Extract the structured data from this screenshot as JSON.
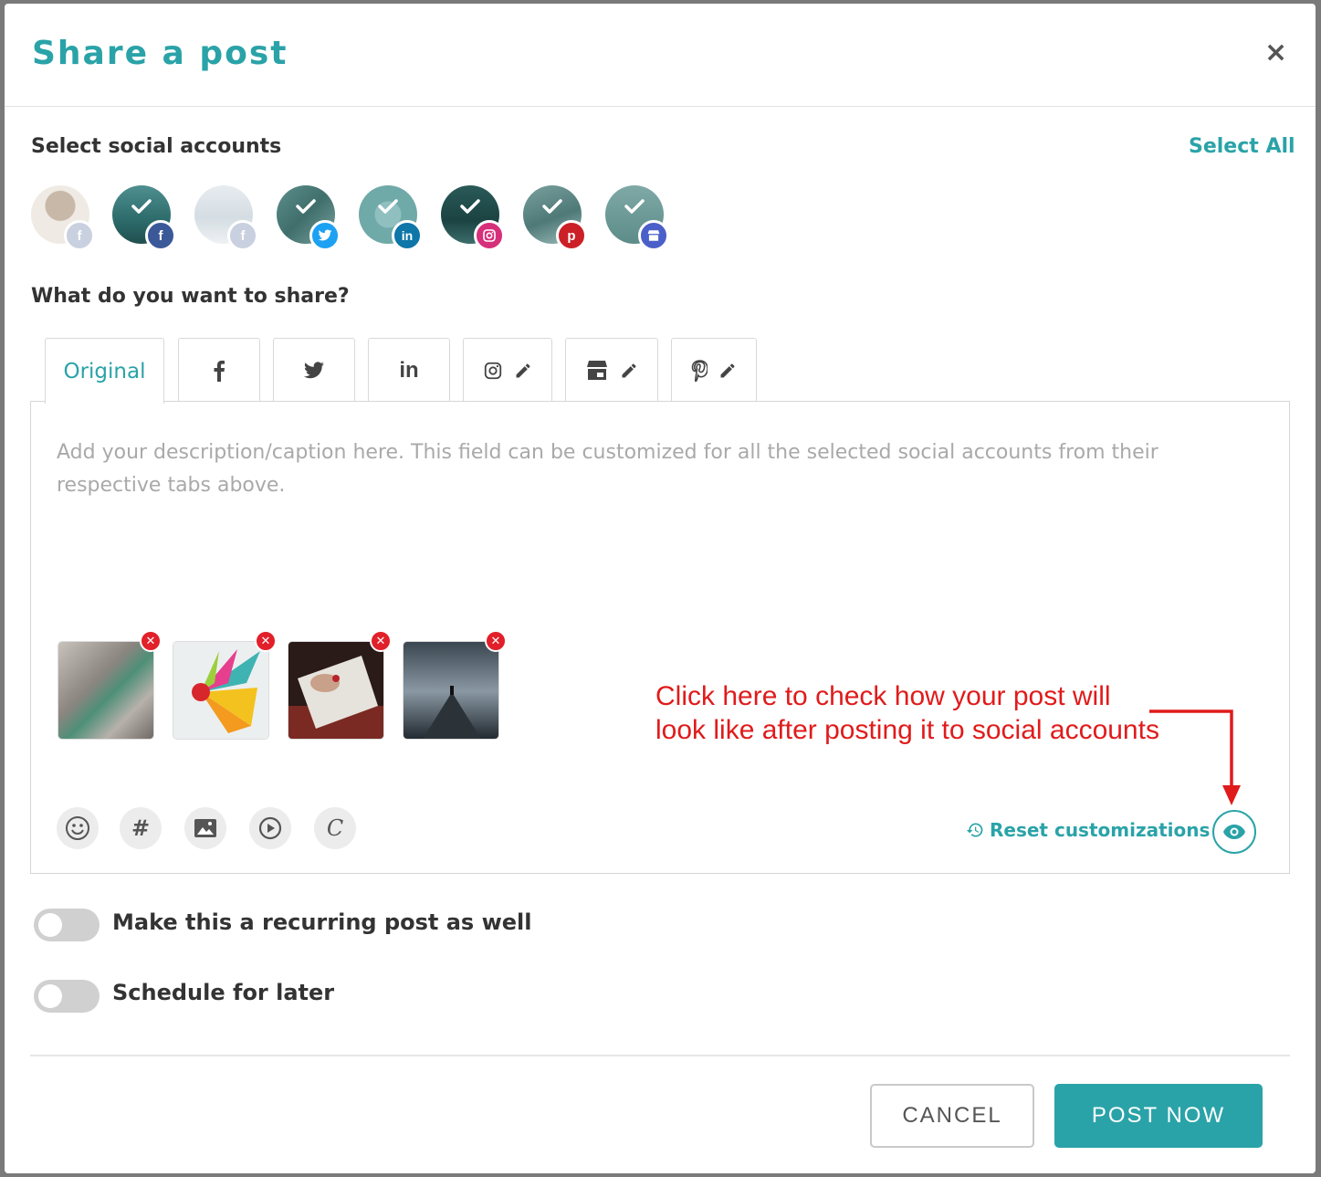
{
  "modal": {
    "title": "Share a post",
    "close_icon": "×"
  },
  "accounts_section": {
    "label": "Select social accounts",
    "select_all": "Select All",
    "accounts": [
      {
        "network": "facebook",
        "selected": false,
        "badge_color": "#c9d0e0",
        "badge_text": "f"
      },
      {
        "network": "facebook",
        "selected": true,
        "badge_color": "#3b5998",
        "badge_text": "f"
      },
      {
        "network": "facebook",
        "selected": false,
        "badge_color": "#c9d0e0",
        "badge_text": "f"
      },
      {
        "network": "twitter",
        "selected": true,
        "badge_color": "#1da1f2",
        "badge_text": "t"
      },
      {
        "network": "linkedin",
        "selected": true,
        "badge_color": "#0e76a8",
        "badge_text": "in"
      },
      {
        "network": "instagram",
        "selected": true,
        "badge_color": "#d6307a",
        "badge_text": "ig"
      },
      {
        "network": "pinterest",
        "selected": true,
        "badge_color": "#cb2027",
        "badge_text": "p"
      },
      {
        "network": "google-business",
        "selected": true,
        "badge_color": "#4b5fc9",
        "badge_text": "g"
      }
    ]
  },
  "share_section": {
    "label": "What do you want to share?",
    "tabs": [
      {
        "label": "Original",
        "icon": ""
      },
      {
        "label": "",
        "icon": "facebook-icon"
      },
      {
        "label": "",
        "icon": "twitter-icon"
      },
      {
        "label": "",
        "icon": "linkedin-icon"
      },
      {
        "label": "",
        "icon": "instagram-icon"
      },
      {
        "label": "",
        "icon": "google-business-icon"
      },
      {
        "label": "",
        "icon": "pinterest-icon"
      }
    ],
    "editor": {
      "placeholder": "Add your description/caption here. This field can be customized for all the selected social accounts from their respective tabs above.",
      "tools": [
        "emoji-icon",
        "hashtag-icon",
        "image-icon",
        "video-icon",
        "canva-icon"
      ],
      "hashtag_glyph": "#",
      "canva_glyph": "C",
      "reset_label": "Reset customizations"
    }
  },
  "annotation": {
    "line1": "Click here to check how your post will",
    "line2": "look like after posting it to social accounts"
  },
  "options": {
    "recurring_label": "Make this a recurring post as well",
    "recurring_on": false,
    "schedule_label": "Schedule for later",
    "schedule_on": false
  },
  "footer": {
    "cancel_label": "CANCEL",
    "post_label": "POST NOW"
  },
  "colors": {
    "accent": "#2aa3a8",
    "annotation": "#e01b1b",
    "remove": "#e1202a"
  }
}
